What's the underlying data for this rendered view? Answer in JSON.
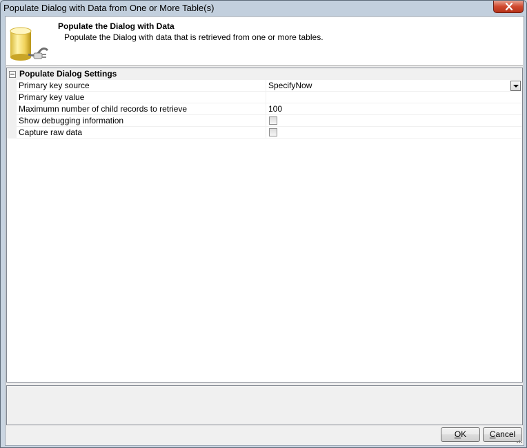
{
  "window": {
    "title": "Populate Dialog with Data from One or More Table(s)"
  },
  "header": {
    "title": "Populate the Dialog with Data",
    "description": "Populate the Dialog with data that is retrieved from one or more tables.",
    "icon": "database-plug-icon"
  },
  "grid": {
    "category": "Populate Dialog Settings",
    "rows": [
      {
        "name": "Primary key source",
        "value": "SpecifyNow"
      },
      {
        "name": "Primary key value",
        "value": ""
      },
      {
        "name": "Maximumn number of child records to retrieve",
        "value": "100"
      },
      {
        "name": "Show debugging information",
        "checked": false
      },
      {
        "name": "Capture raw data",
        "checked": false
      }
    ]
  },
  "buttons": {
    "ok_mnemonic": "O",
    "ok_rest": "K",
    "cancel_mnemonic": "C",
    "cancel_rest": "ancel"
  }
}
